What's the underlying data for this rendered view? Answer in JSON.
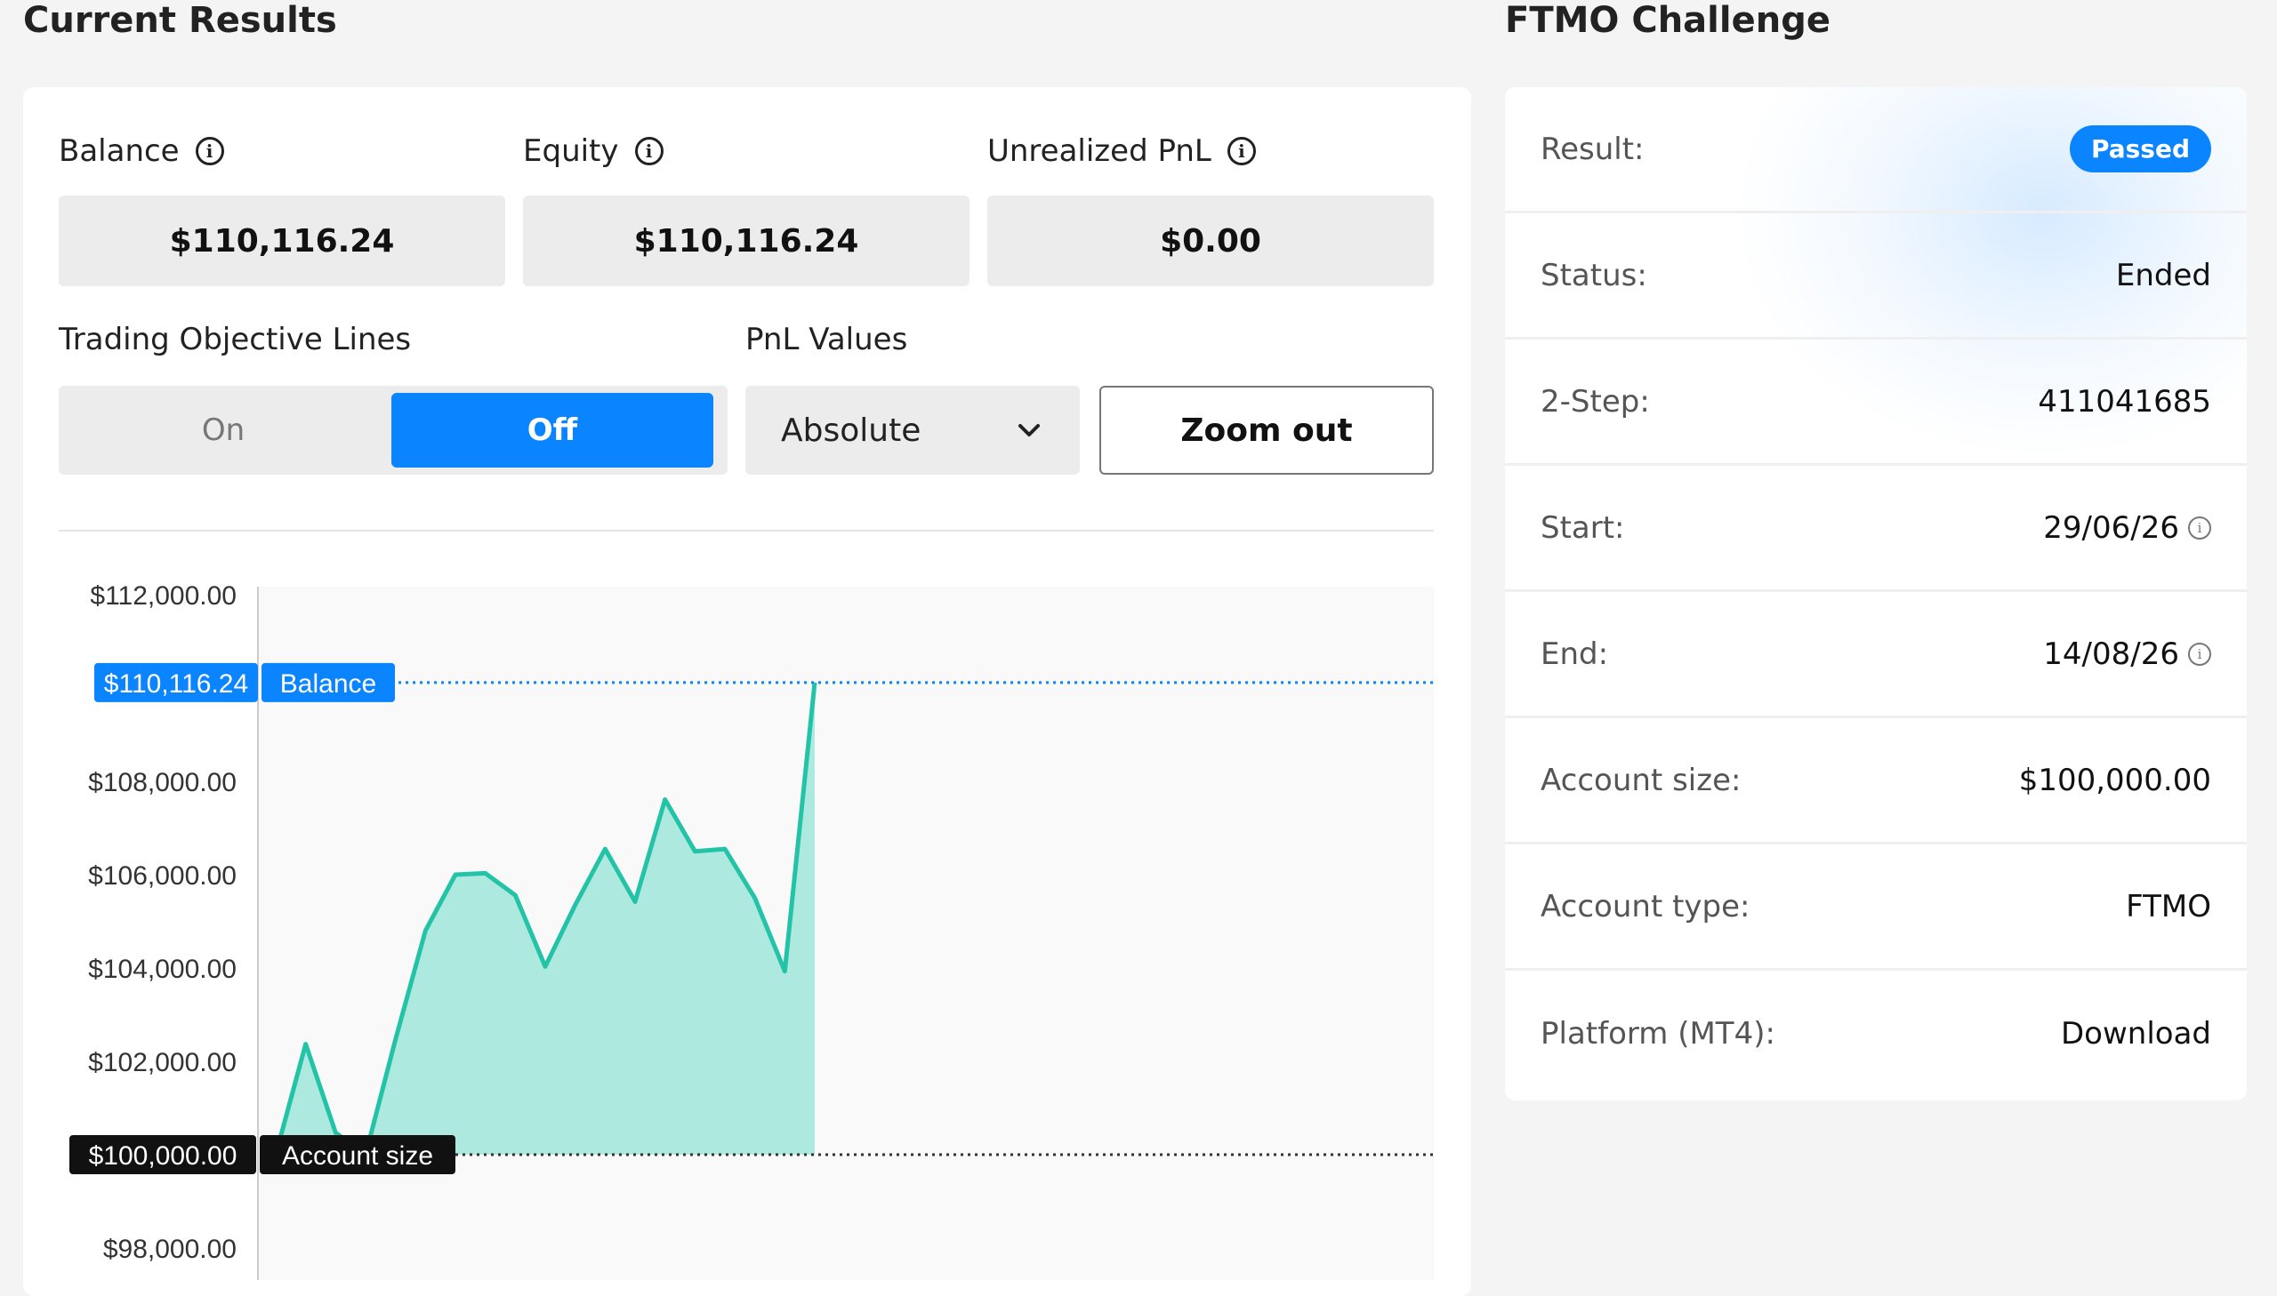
{
  "left_section": {
    "title": "Current Results",
    "metrics": [
      {
        "label": "Balance",
        "value": "$110,116.24"
      },
      {
        "label": "Equity",
        "value": "$110,116.24"
      },
      {
        "label": "Unrealized PnL",
        "value": "$0.00"
      }
    ],
    "objective_lines": {
      "label": "Trading Objective Lines",
      "on_label": "On",
      "off_label": "Off",
      "selected": "Off"
    },
    "pnl_values": {
      "label": "PnL Values",
      "selected": "Absolute"
    },
    "zoom_out_label": "Zoom out"
  },
  "chart_data": {
    "type": "area",
    "y_ticks": [
      "$112,000.00",
      "$108,000.00",
      "$106,000.00",
      "$104,000.00",
      "$102,000.00",
      "$98,000.00"
    ],
    "ylim": [
      97800,
      112300
    ],
    "values": [
      100000,
      102370,
      100470,
      100000,
      102470,
      104800,
      106000,
      106030,
      105560,
      104030,
      105350,
      106550,
      105420,
      107610,
      106500,
      106550,
      105500,
      103930,
      110116.24
    ],
    "balance_line": {
      "value_label": "$110,116.24",
      "name": "Balance",
      "value": 110116.24
    },
    "account_size_line": {
      "value_label": "$100,000.00",
      "name": "Account size",
      "value": 100000
    },
    "line_color": "#22c3a6",
    "fill_color": "#aee9e0",
    "balance_color": "#0a84ff"
  },
  "right_section": {
    "title": "FTMO Challenge",
    "rows": [
      {
        "label": "Result:",
        "value": "Passed"
      },
      {
        "label": "Status:",
        "value": "Ended"
      },
      {
        "label": "2-Step:",
        "value": "411041685"
      },
      {
        "label": "Start:",
        "value": "29/06/26"
      },
      {
        "label": "End:",
        "value": "14/08/26"
      },
      {
        "label": "Account size:",
        "value": "$100,000.00"
      },
      {
        "label": "Account type:",
        "value": "FTMO"
      },
      {
        "label": "Platform (MT4):",
        "value": "Download"
      }
    ]
  }
}
